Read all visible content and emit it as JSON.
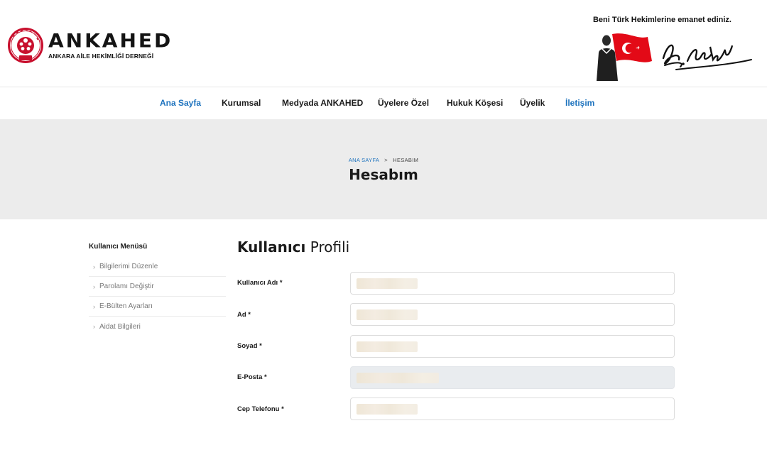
{
  "brand": {
    "title": "ANKAHED",
    "subtitle": "ANKARA AİLE HEKİMLİĞİ DERNEĞİ",
    "seal_text": "ANKARA AİLE HEKİMLİĞİ DERNEĞİ",
    "seal_year": "2011"
  },
  "header": {
    "quote": "Beni Türk Hekimlerine emanet ediniz."
  },
  "nav": {
    "items": [
      "Ana Sayfa",
      "Kurumsal",
      "Medyada ANKAHED",
      "Üyelere Özel",
      "Hukuk Köşesi",
      "Üyelik",
      "İletişim"
    ]
  },
  "hero": {
    "breadcrumb_home": "ANA SAYFA",
    "breadcrumb_sep": ">",
    "breadcrumb_current": "HESABIM",
    "title": "Hesabım"
  },
  "sidebar": {
    "title": "Kullanıcı Menüsü",
    "items": [
      "Bilgilerimi Düzenle",
      "Parolamı Değiştir",
      "E-Bülten Ayarları",
      "Aidat Bilgileri"
    ]
  },
  "profile": {
    "title_strong": "Kullanıcı",
    "title_light": "Profili",
    "fields": [
      {
        "label": "Kullanıcı Adı *",
        "disabled": false
      },
      {
        "label": "Ad *",
        "disabled": false
      },
      {
        "label": "Soyad *",
        "disabled": false
      },
      {
        "label": "E-Posta *",
        "disabled": true
      },
      {
        "label": "Cep Telefonu *",
        "disabled": false
      }
    ]
  },
  "colors": {
    "accent": "#1e73be",
    "hero_bg": "#ececec",
    "flag_red": "#e30a17"
  }
}
